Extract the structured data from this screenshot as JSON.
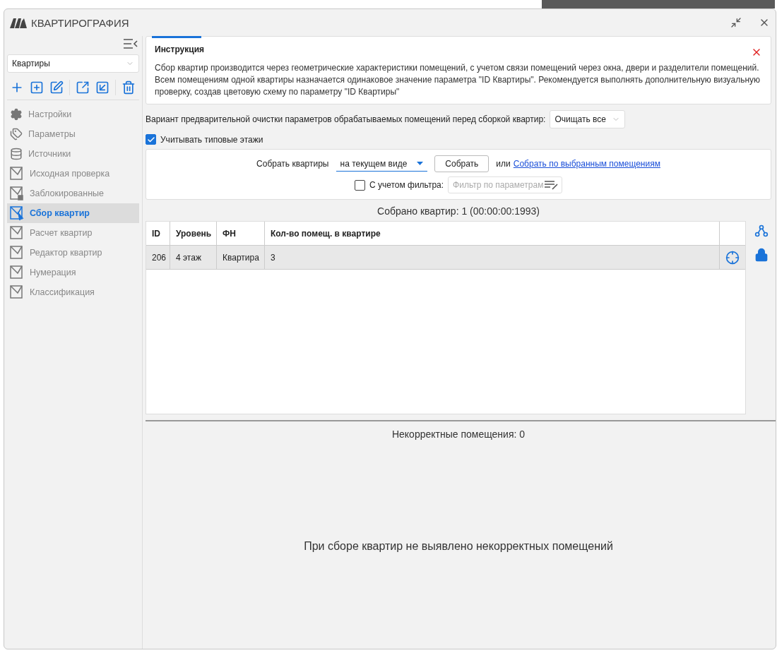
{
  "window": {
    "title": "КВАРТИРОГРАФИЯ"
  },
  "sidebar": {
    "dropdown": {
      "value": "Квартиры"
    },
    "items": [
      {
        "label": "Настройки",
        "selected": false
      },
      {
        "label": "Параметры",
        "selected": false
      },
      {
        "label": "Источники",
        "selected": false
      },
      {
        "label": "Исходная проверка",
        "selected": false
      },
      {
        "label": "Заблокированные",
        "selected": false
      },
      {
        "label": "Сбор квартир",
        "selected": true
      },
      {
        "label": "Расчет квартир",
        "selected": false
      },
      {
        "label": "Редактор квартир",
        "selected": false
      },
      {
        "label": "Нумерация",
        "selected": false
      },
      {
        "label": "Классификация",
        "selected": false
      }
    ]
  },
  "instruction": {
    "title": "Инструкция",
    "text": "Сбор квартир производится через геометрические характеристики помещений, с учетом связи помещений через окна, двери и разделители помещений. Всем помещениям одной квартиры назначается одинаковое значение параметра \"ID Квартиры\". Рекомендуется выполнять дополнительную визуальную проверку, создав цветовую схему по параметру \"ID Квартиры\""
  },
  "cleanup": {
    "label": "Вариант предварительной очистки параметров обрабатываемых помещений перед сборкой квартир:",
    "value": "Очищать все"
  },
  "typical_floors": {
    "label": "Учитывать типовые этажи",
    "checked": true
  },
  "collect": {
    "label": "Собрать квартиры",
    "mode": "на текущем виде",
    "button": "Собрать",
    "or": "или",
    "link": "Собрать по выбранным помещениям",
    "filter": {
      "label": "С учетом фильтра:",
      "checked": false,
      "placeholder": "Фильтр по параметрам"
    }
  },
  "summary": "Собрано квартир: 1 (00:00:00:1993)",
  "table": {
    "columns": [
      "ID",
      "Уровень",
      "ФН",
      "Кол-во помещ. в квартире"
    ],
    "rows": [
      {
        "cells": [
          "206",
          "4 этаж",
          "Квартира",
          "3"
        ],
        "selected": true
      }
    ]
  },
  "errors": {
    "title": "Некорректные помещения: 0",
    "message": "При сборе квартир не выявлено некорректных помещений"
  }
}
